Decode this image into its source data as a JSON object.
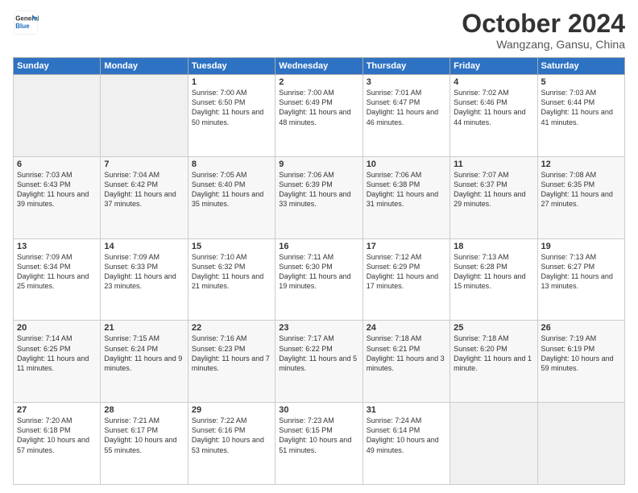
{
  "logo": {
    "general": "General",
    "blue": "Blue"
  },
  "header": {
    "month": "October 2024",
    "location": "Wangzang, Gansu, China"
  },
  "weekdays": [
    "Sunday",
    "Monday",
    "Tuesday",
    "Wednesday",
    "Thursday",
    "Friday",
    "Saturday"
  ],
  "weeks": [
    [
      {
        "day": "",
        "empty": true
      },
      {
        "day": "",
        "empty": true
      },
      {
        "day": "1",
        "sunrise": "7:00 AM",
        "sunset": "6:50 PM",
        "daylight": "11 hours and 50 minutes."
      },
      {
        "day": "2",
        "sunrise": "7:00 AM",
        "sunset": "6:49 PM",
        "daylight": "11 hours and 48 minutes."
      },
      {
        "day": "3",
        "sunrise": "7:01 AM",
        "sunset": "6:47 PM",
        "daylight": "11 hours and 46 minutes."
      },
      {
        "day": "4",
        "sunrise": "7:02 AM",
        "sunset": "6:46 PM",
        "daylight": "11 hours and 44 minutes."
      },
      {
        "day": "5",
        "sunrise": "7:03 AM",
        "sunset": "6:44 PM",
        "daylight": "11 hours and 41 minutes."
      }
    ],
    [
      {
        "day": "6",
        "sunrise": "7:03 AM",
        "sunset": "6:43 PM",
        "daylight": "11 hours and 39 minutes."
      },
      {
        "day": "7",
        "sunrise": "7:04 AM",
        "sunset": "6:42 PM",
        "daylight": "11 hours and 37 minutes."
      },
      {
        "day": "8",
        "sunrise": "7:05 AM",
        "sunset": "6:40 PM",
        "daylight": "11 hours and 35 minutes."
      },
      {
        "day": "9",
        "sunrise": "7:06 AM",
        "sunset": "6:39 PM",
        "daylight": "11 hours and 33 minutes."
      },
      {
        "day": "10",
        "sunrise": "7:06 AM",
        "sunset": "6:38 PM",
        "daylight": "11 hours and 31 minutes."
      },
      {
        "day": "11",
        "sunrise": "7:07 AM",
        "sunset": "6:37 PM",
        "daylight": "11 hours and 29 minutes."
      },
      {
        "day": "12",
        "sunrise": "7:08 AM",
        "sunset": "6:35 PM",
        "daylight": "11 hours and 27 minutes."
      }
    ],
    [
      {
        "day": "13",
        "sunrise": "7:09 AM",
        "sunset": "6:34 PM",
        "daylight": "11 hours and 25 minutes."
      },
      {
        "day": "14",
        "sunrise": "7:09 AM",
        "sunset": "6:33 PM",
        "daylight": "11 hours and 23 minutes."
      },
      {
        "day": "15",
        "sunrise": "7:10 AM",
        "sunset": "6:32 PM",
        "daylight": "11 hours and 21 minutes."
      },
      {
        "day": "16",
        "sunrise": "7:11 AM",
        "sunset": "6:30 PM",
        "daylight": "11 hours and 19 minutes."
      },
      {
        "day": "17",
        "sunrise": "7:12 AM",
        "sunset": "6:29 PM",
        "daylight": "11 hours and 17 minutes."
      },
      {
        "day": "18",
        "sunrise": "7:13 AM",
        "sunset": "6:28 PM",
        "daylight": "11 hours and 15 minutes."
      },
      {
        "day": "19",
        "sunrise": "7:13 AM",
        "sunset": "6:27 PM",
        "daylight": "11 hours and 13 minutes."
      }
    ],
    [
      {
        "day": "20",
        "sunrise": "7:14 AM",
        "sunset": "6:25 PM",
        "daylight": "11 hours and 11 minutes."
      },
      {
        "day": "21",
        "sunrise": "7:15 AM",
        "sunset": "6:24 PM",
        "daylight": "11 hours and 9 minutes."
      },
      {
        "day": "22",
        "sunrise": "7:16 AM",
        "sunset": "6:23 PM",
        "daylight": "11 hours and 7 minutes."
      },
      {
        "day": "23",
        "sunrise": "7:17 AM",
        "sunset": "6:22 PM",
        "daylight": "11 hours and 5 minutes."
      },
      {
        "day": "24",
        "sunrise": "7:18 AM",
        "sunset": "6:21 PM",
        "daylight": "11 hours and 3 minutes."
      },
      {
        "day": "25",
        "sunrise": "7:18 AM",
        "sunset": "6:20 PM",
        "daylight": "11 hours and 1 minute."
      },
      {
        "day": "26",
        "sunrise": "7:19 AM",
        "sunset": "6:19 PM",
        "daylight": "10 hours and 59 minutes."
      }
    ],
    [
      {
        "day": "27",
        "sunrise": "7:20 AM",
        "sunset": "6:18 PM",
        "daylight": "10 hours and 57 minutes."
      },
      {
        "day": "28",
        "sunrise": "7:21 AM",
        "sunset": "6:17 PM",
        "daylight": "10 hours and 55 minutes."
      },
      {
        "day": "29",
        "sunrise": "7:22 AM",
        "sunset": "6:16 PM",
        "daylight": "10 hours and 53 minutes."
      },
      {
        "day": "30",
        "sunrise": "7:23 AM",
        "sunset": "6:15 PM",
        "daylight": "10 hours and 51 minutes."
      },
      {
        "day": "31",
        "sunrise": "7:24 AM",
        "sunset": "6:14 PM",
        "daylight": "10 hours and 49 minutes."
      },
      {
        "day": "",
        "empty": true
      },
      {
        "day": "",
        "empty": true
      }
    ]
  ],
  "labels": {
    "sunrise": "Sunrise:",
    "sunset": "Sunset:",
    "daylight": "Daylight:"
  }
}
